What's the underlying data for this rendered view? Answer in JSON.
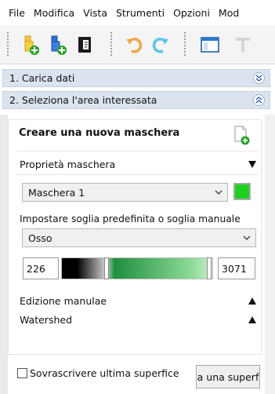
{
  "menu": [
    "File",
    "Modifica",
    "Vista",
    "Strumenti",
    "Opzioni",
    "Mod"
  ],
  "panels": {
    "load": {
      "label": "1. Carica dati"
    },
    "select": {
      "label": "2. Seleziona l'area interessata"
    }
  },
  "mask": {
    "title": "Creare una nuova maschera",
    "properties_label": "Proprietà maschera",
    "current_mask": "Maschera 1",
    "color": "#1fd11f",
    "threshold_label": "Impostare soglia predefinita o soglia manuale",
    "preset": "Osso",
    "min": "226",
    "max": "3071",
    "manual_edit_label": "Edizione manulae",
    "watershed_label": "Watershed",
    "overwrite_label": "Sovrascrivere ultima superfice",
    "apply_label": "a una superf"
  },
  "icons": [
    "new-project-icon",
    "import-icon",
    "export-icon",
    "undo-icon",
    "redo-icon",
    "window-icon",
    "text-icon",
    "new-mask-icon"
  ],
  "colors": {
    "accent": "#1fd11f",
    "header": "#dbe3ee"
  }
}
